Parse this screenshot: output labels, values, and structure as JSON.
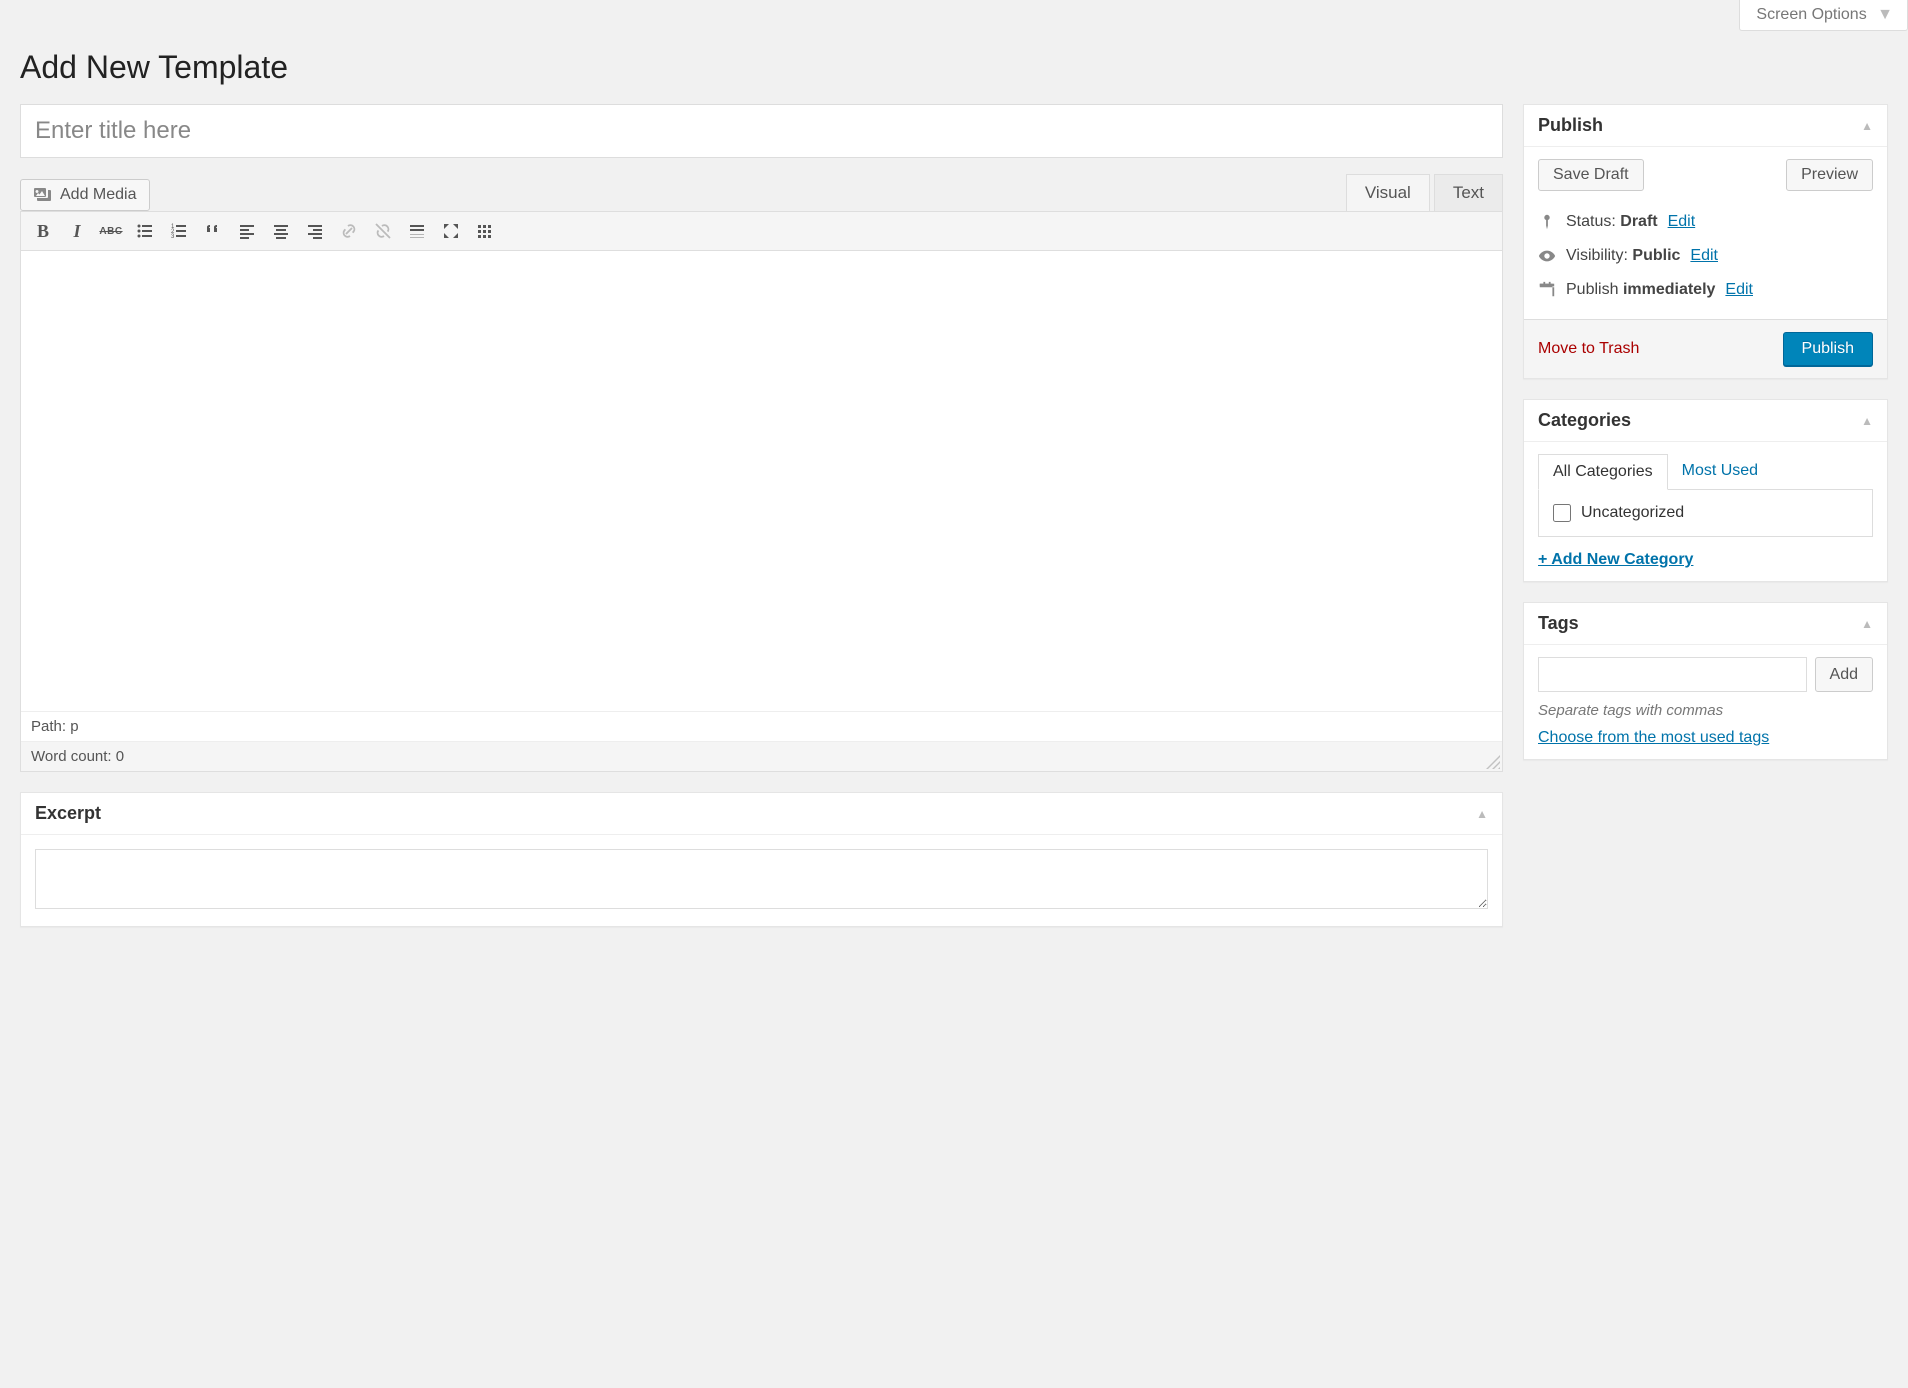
{
  "screen_options_label": "Screen Options",
  "page_title": "Add New Template",
  "title_placeholder": "Enter title here",
  "title_value": "",
  "add_media_label": "Add Media",
  "editor_tabs": {
    "visual": "Visual",
    "text": "Text"
  },
  "toolbar_icons": [
    "bold",
    "italic",
    "strikethrough",
    "bullet-list",
    "numbered-list",
    "blockquote",
    "align-left",
    "align-center",
    "align-right",
    "link",
    "unlink",
    "insert-more",
    "fullscreen",
    "kitchen-sink"
  ],
  "editor_path_label": "Path:",
  "editor_path_value": "p",
  "word_count_label": "Word count:",
  "word_count_value": "0",
  "excerpt": {
    "title": "Excerpt",
    "value": ""
  },
  "publish": {
    "title": "Publish",
    "save_draft": "Save Draft",
    "preview": "Preview",
    "status_label": "Status:",
    "status_value": "Draft",
    "visibility_label": "Visibility:",
    "visibility_value": "Public",
    "schedule_label": "Publish",
    "schedule_value": "immediately",
    "edit_label": "Edit",
    "trash_label": "Move to Trash",
    "publish_button": "Publish"
  },
  "categories": {
    "title": "Categories",
    "tab_all": "All Categories",
    "tab_most": "Most Used",
    "items": [
      "Uncategorized"
    ],
    "add_new": "+ Add New Category"
  },
  "tags": {
    "title": "Tags",
    "add_button": "Add",
    "input_value": "",
    "hint": "Separate tags with commas",
    "choose": "Choose from the most used tags"
  }
}
